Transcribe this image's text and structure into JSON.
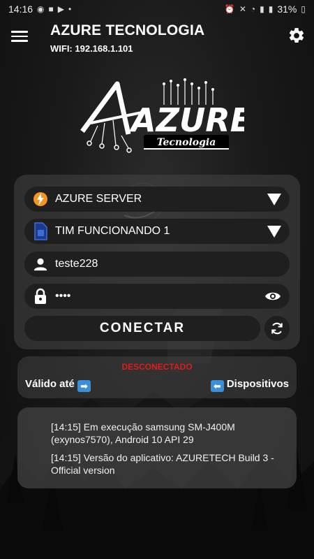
{
  "status_bar": {
    "time": "14:16",
    "battery": "31%"
  },
  "header": {
    "title": "AZURE TECNOLOGIA",
    "subtitle": "WIFI: 192.168.1.101"
  },
  "logo": {
    "main": "AZURE",
    "sub": "Tecnologia"
  },
  "form": {
    "server": "AZURE SERVER",
    "network": "TIM FUNCIONANDO 1",
    "username": "teste228",
    "password": "••••",
    "connect_label": "CONECTAR"
  },
  "status": {
    "connection": "DESCONECTADO",
    "valid_label": "Válido até",
    "devices_label": "Dispositivos"
  },
  "logs": [
    "[14:15] Em execução samsung SM-J400M (exynos7570), Android 10 API 29",
    "[14:15] Versão do aplicativo: AZURETECH Build 3 - Official version"
  ],
  "colors": {
    "accent_blue": "#3b8fd6",
    "disconnected_red": "#e01b1b",
    "server_icon": "#f7931e"
  }
}
